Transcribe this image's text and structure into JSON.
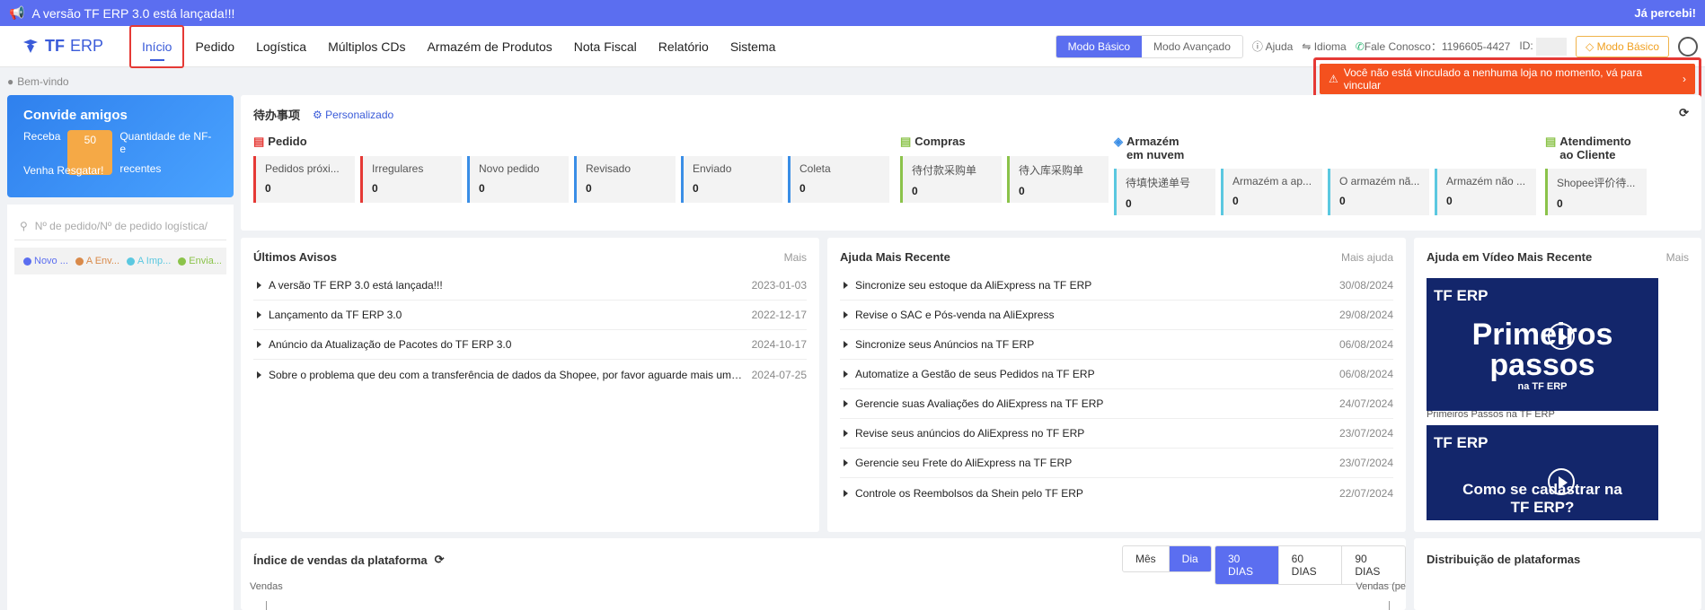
{
  "banner": {
    "message": "A versão TF ERP 3.0 está lançada!!!",
    "dismiss": "Já percebi!"
  },
  "logo": {
    "tf": "TF",
    "erp": "ERP"
  },
  "menu": [
    "Início",
    "Pedido",
    "Logística",
    "Múltiplos CDs",
    "Armazém de Produtos",
    "Nota Fiscal",
    "Relatório",
    "Sistema"
  ],
  "header": {
    "mode_basic": "Modo Básico",
    "mode_advanced": "Modo Avançado",
    "help": "Ajuda",
    "language": "Idioma",
    "contact": "Fale Conosco：1196605-4427",
    "id_label": "ID:",
    "plan_button": "Modo Básico"
  },
  "breadcrumb": "Bem-vindo",
  "warning": "Você não está vinculado a nenhuma loja no momento, vá para vincular",
  "invite": {
    "title": "Convide amigos",
    "receive": "Receba",
    "count": "50",
    "desc1": "Quantidade de NF-e",
    "desc2": "recentes",
    "cta": "Venha Resgatar!"
  },
  "search": {
    "placeholder": "Nº de pedido/Nº de pedido logística/"
  },
  "legend": [
    {
      "label": "Novo ...",
      "color": "#5b6ef0"
    },
    {
      "label": "A Env...",
      "color": "#d98a4a"
    },
    {
      "label": "A Imp...",
      "color": "#5bc8e0"
    },
    {
      "label": "Envia...",
      "color": "#8bc34a"
    }
  ],
  "todo": {
    "title": "待办事项",
    "custom": "Personalizado",
    "groups": [
      {
        "name": "Pedido",
        "tiles": [
          {
            "label": "Pedidos próxi...",
            "value": "0"
          },
          {
            "label": "Irregulares",
            "value": "0"
          },
          {
            "label": "Novo pedido",
            "value": "0"
          },
          {
            "label": "Revisado",
            "value": "0"
          },
          {
            "label": "Enviado",
            "value": "0"
          },
          {
            "label": "Coleta",
            "value": "0"
          }
        ]
      },
      {
        "name": "Compras",
        "tiles": [
          {
            "label": "待付款采购单",
            "value": "0"
          },
          {
            "label": "待入库采购单",
            "value": "0"
          }
        ]
      },
      {
        "name": "Armazém",
        "name2": "em nuvem",
        "tiles": [
          {
            "label": "待填快递单号",
            "value": "0"
          },
          {
            "label": "Armazém a ap...",
            "value": "0"
          },
          {
            "label": "O armazém nã...",
            "value": "0"
          },
          {
            "label": "Armazém não ...",
            "value": "0"
          }
        ]
      },
      {
        "name": "Atendimento",
        "name2": "ao Cliente",
        "tiles": [
          {
            "label": "Shopee评价待...",
            "value": "0"
          }
        ]
      }
    ]
  },
  "notices": {
    "title": "Últimos Avisos",
    "more": "Mais",
    "items": [
      {
        "text": "A versão TF ERP 3.0 está lançada!!!",
        "date": "2023-01-03"
      },
      {
        "text": "Lançamento da TF ERP 3.0",
        "date": "2022-12-17"
      },
      {
        "text": "Anúncio da Atualização de Pacotes do TF ERP 3.0",
        "date": "2024-10-17"
      },
      {
        "text": "Sobre o problema que deu com a transferência de dados da Shopee, por favor aguarde mais um p...",
        "date": "2024-07-25"
      }
    ]
  },
  "help": {
    "title": "Ajuda Mais Recente",
    "more": "Mais ajuda",
    "items": [
      {
        "text": "Sincronize seu estoque da AliExpress na TF ERP",
        "date": "30/08/2024"
      },
      {
        "text": "Revise o SAC e Pós-venda na AliExpress",
        "date": "29/08/2024"
      },
      {
        "text": "Sincronize seus Anúncios na TF ERP",
        "date": "06/08/2024"
      },
      {
        "text": "Automatize a Gestão de seus Pedidos na TF ERP",
        "date": "06/08/2024"
      },
      {
        "text": "Gerencie suas Avaliações do AliExpress na TF ERP",
        "date": "24/07/2024"
      },
      {
        "text": "Revise seus anúncios do AliExpress no TF ERP",
        "date": "23/07/2024"
      },
      {
        "text": "Gerencie seu Frete do AliExpress na TF ERP",
        "date": "23/07/2024"
      },
      {
        "text": "Controle os Reembolsos da Shein pelo TF ERP",
        "date": "22/07/2024"
      }
    ]
  },
  "videos": {
    "title": "Ajuda em Vídeo Mais Recente",
    "more": "Mais",
    "v1": {
      "brand": "TF ERP",
      "line1": "Primeiros",
      "line2": "passos",
      "sub": "na TF ERP",
      "caption": "Primeiros Passos na TF ERP"
    },
    "v2": {
      "brand": "TF ERP",
      "line1": "Como se cadastrar na",
      "line2": "TF ERP?"
    }
  },
  "sales": {
    "title": "Índice de vendas da plataforma",
    "period": [
      "Mês",
      "Dia"
    ],
    "range": [
      "30 DIAS",
      "60 DIAS",
      "90 DIAS"
    ],
    "ylabel_left": "Vendas",
    "ylabel_right": "Vendas (pe"
  },
  "distribution": {
    "title": "Distribuição de plataformas"
  },
  "colors": {
    "accent": "#5b6ef0",
    "warning": "#f4511e",
    "highlight": "#e53935"
  }
}
